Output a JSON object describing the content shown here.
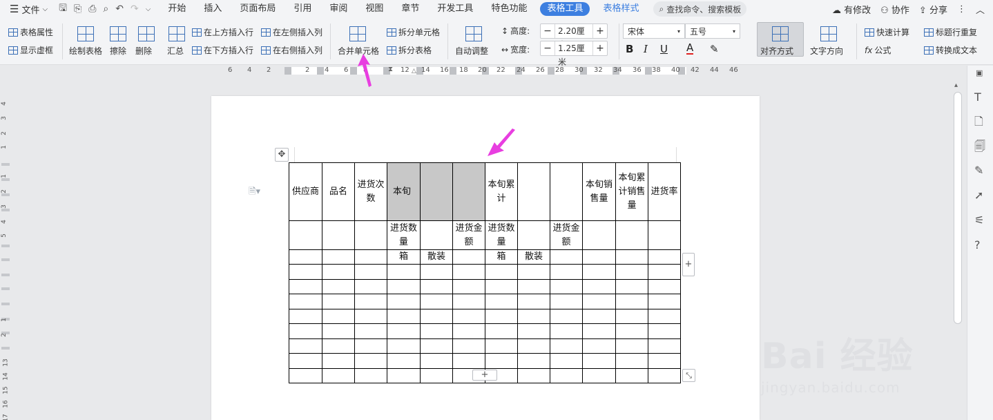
{
  "menubar": {
    "file_label": "文件",
    "tabs": [
      "开始",
      "插入",
      "页面布局",
      "引用",
      "审阅",
      "视图",
      "章节",
      "开发工具",
      "特色功能",
      "表格工具",
      "表格样式"
    ],
    "search_label": "查找命令、搜索模板",
    "modified_label": "有修改",
    "collab_label": "协作",
    "share_label": "分享"
  },
  "ribbon": {
    "table_props": "表格属性",
    "show_grid": "显示虚框",
    "draw_table": "绘制表格",
    "erase": "擦除",
    "delete": "删除",
    "summary": "汇总",
    "insert_row_above": "在上方插入行",
    "insert_row_below": "在下方插入行",
    "insert_col_left": "在左侧插入列",
    "insert_col_right": "在右侧插入列",
    "merge_cells": "合并单元格",
    "split_cells": "拆分单元格",
    "split_table": "拆分表格",
    "auto_fit": "自动调整",
    "height_label": "高度:",
    "height_value": "2.20厘米",
    "width_label": "宽度:",
    "width_value": "1.25厘米",
    "font_name": "宋体",
    "font_size": "五号",
    "align": "对齐方式",
    "text_dir": "文字方向",
    "quick_calc": "快速计算",
    "formula": "公式",
    "repeat_header": "标题行重复",
    "to_text": "转换成文本"
  },
  "ruler": {
    "ticks": [
      "6",
      "4",
      "2",
      "2",
      "4",
      "6",
      "8",
      "12",
      "14",
      "16",
      "18",
      "20",
      "22",
      "24",
      "26",
      "28",
      "30",
      "32",
      "34",
      "36",
      "38",
      "40",
      "42",
      "44",
      "46"
    ],
    "vticks": [
      "4",
      "3",
      "2",
      "1",
      "1",
      "2",
      "3",
      "4",
      "5",
      "1",
      "2",
      "13",
      "14",
      "15",
      "16",
      "17"
    ]
  },
  "table": {
    "header": [
      "供应商",
      "品名",
      "进货次数",
      "本旬",
      "",
      "",
      "本旬累计",
      "",
      "",
      "本旬销售量",
      "本旬累计销售量",
      "进货率"
    ],
    "row2": [
      "",
      "",
      "",
      "进货数量",
      "",
      "进货金额",
      "进货数量",
      "",
      "进货金额",
      "",
      "",
      ""
    ],
    "row3": [
      "",
      "",
      "",
      "箱",
      "散装",
      "",
      "箱",
      "散装",
      "",
      "",
      "",
      ""
    ],
    "empty_rows": 8
  },
  "watermark": {
    "brand": "Bai 经验",
    "url": "jingyan.baidu.com"
  },
  "colors": {
    "accent": "#3d7fe0",
    "arrow": "#e83ee0",
    "shade": "#c8c8c8"
  }
}
